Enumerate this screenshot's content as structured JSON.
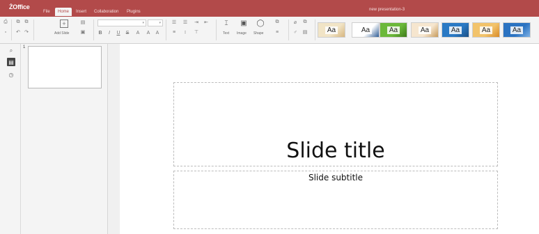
{
  "app": {
    "logo": "ŻOffice",
    "document_title": "new presentation-3"
  },
  "menu": {
    "tabs": [
      {
        "label": "File"
      },
      {
        "label": "Home"
      },
      {
        "label": "Insert"
      },
      {
        "label": "Collaboration"
      },
      {
        "label": "Plugins"
      }
    ],
    "active": "Home"
  },
  "toolbar": {
    "add_slide_label": "Add Slide",
    "text_label": "Text",
    "image_label": "Image",
    "shape_label": "Shape",
    "font_name": "",
    "font_size": "",
    "icons": [
      "print-icon",
      "save-icon",
      "copy-icon",
      "paste-icon",
      "undo-icon",
      "redo-icon",
      "add-slide-icon",
      "change-layout-icon",
      "reset-slide-icon",
      "bold-icon",
      "italic-icon",
      "underline-icon",
      "strikethrough-icon",
      "font-color-icon",
      "bullets-icon",
      "numbering-icon",
      "indent-icon",
      "align-icon",
      "text-box-icon",
      "image-icon",
      "shape-icon",
      "arrange-icon",
      "clear-style-icon",
      "copy-style-icon"
    ]
  },
  "themes": [
    {
      "label": "Aa",
      "bg": "#f1e4c6",
      "accent": "#d6b57e"
    },
    {
      "label": "Aa",
      "bg": "#ffffff",
      "accent": "#2f5d96"
    },
    {
      "label": "Aa",
      "bg": "#6bb83a",
      "accent": "#3e7a1a"
    },
    {
      "label": "Aa",
      "bg": "#f6e6cf",
      "accent": "#c79a5a"
    },
    {
      "label": "Aa",
      "bg": "#2a79c4",
      "accent": "#1a4f85"
    },
    {
      "label": "Aa",
      "bg": "#f2c36b",
      "accent": "#d88a26"
    },
    {
      "label": "Aa",
      "bg": "#2b73c2",
      "accent": "#7fb2e6"
    }
  ],
  "left_panel": {
    "icons": [
      "search-icon",
      "slides-icon",
      "history-icon"
    ]
  },
  "thumbnails": {
    "slides": [
      {
        "number": "1"
      }
    ]
  },
  "slide": {
    "title": "Slide title",
    "subtitle": "Slide subtitle"
  }
}
